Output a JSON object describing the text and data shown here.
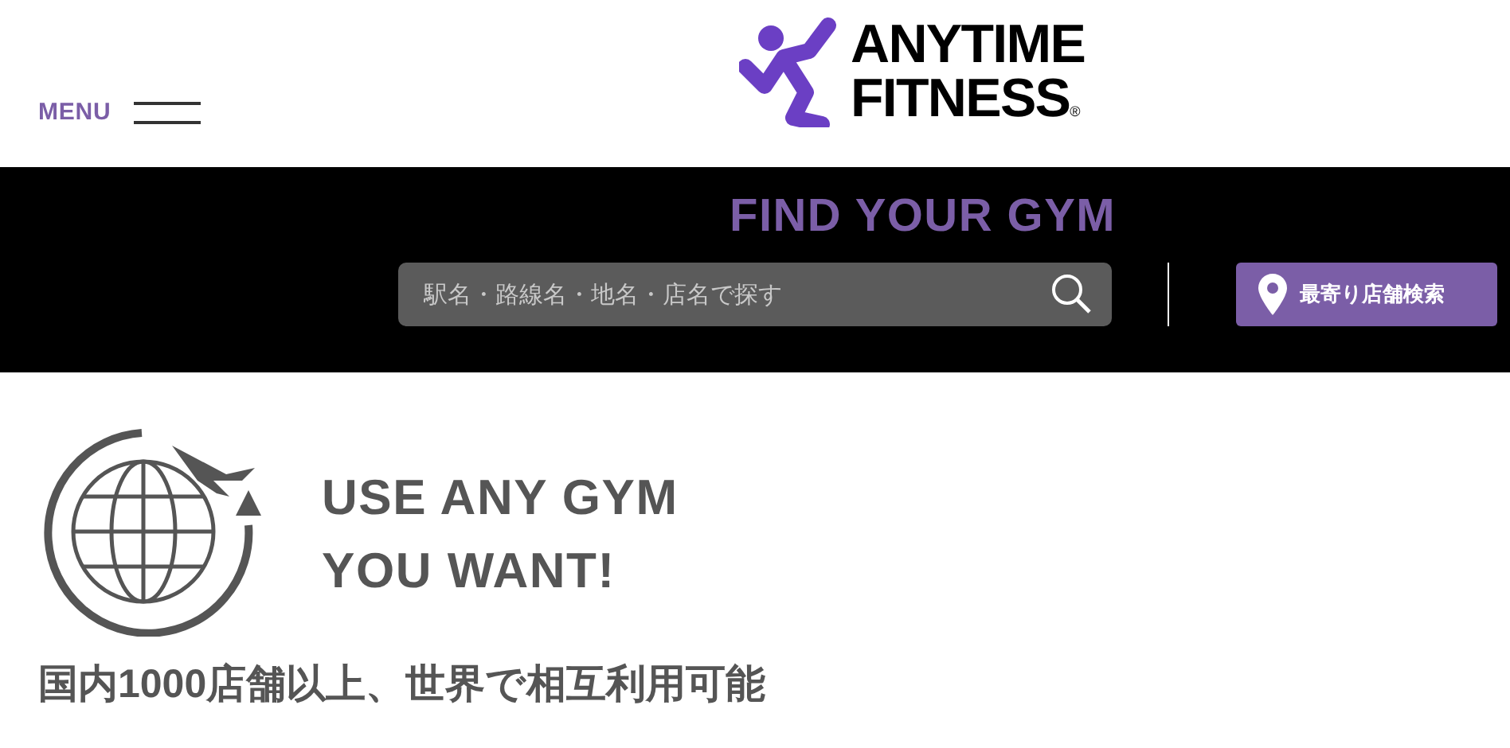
{
  "header": {
    "menu_label": "MENU",
    "logo": {
      "line_1": "ANYTIME",
      "line_2": "FITNESS",
      "mark": "®"
    }
  },
  "finder": {
    "title": "FIND YOUR GYM",
    "search": {
      "placeholder": "駅名・路線名・地名・店名で探す"
    },
    "nearby_button": "最寄り店舗検索"
  },
  "feature": {
    "headline": [
      "USE ANY GYM",
      "YOU WANT!"
    ],
    "subtitle": "国内1000店舗以上、世界で相互利用可能"
  }
}
